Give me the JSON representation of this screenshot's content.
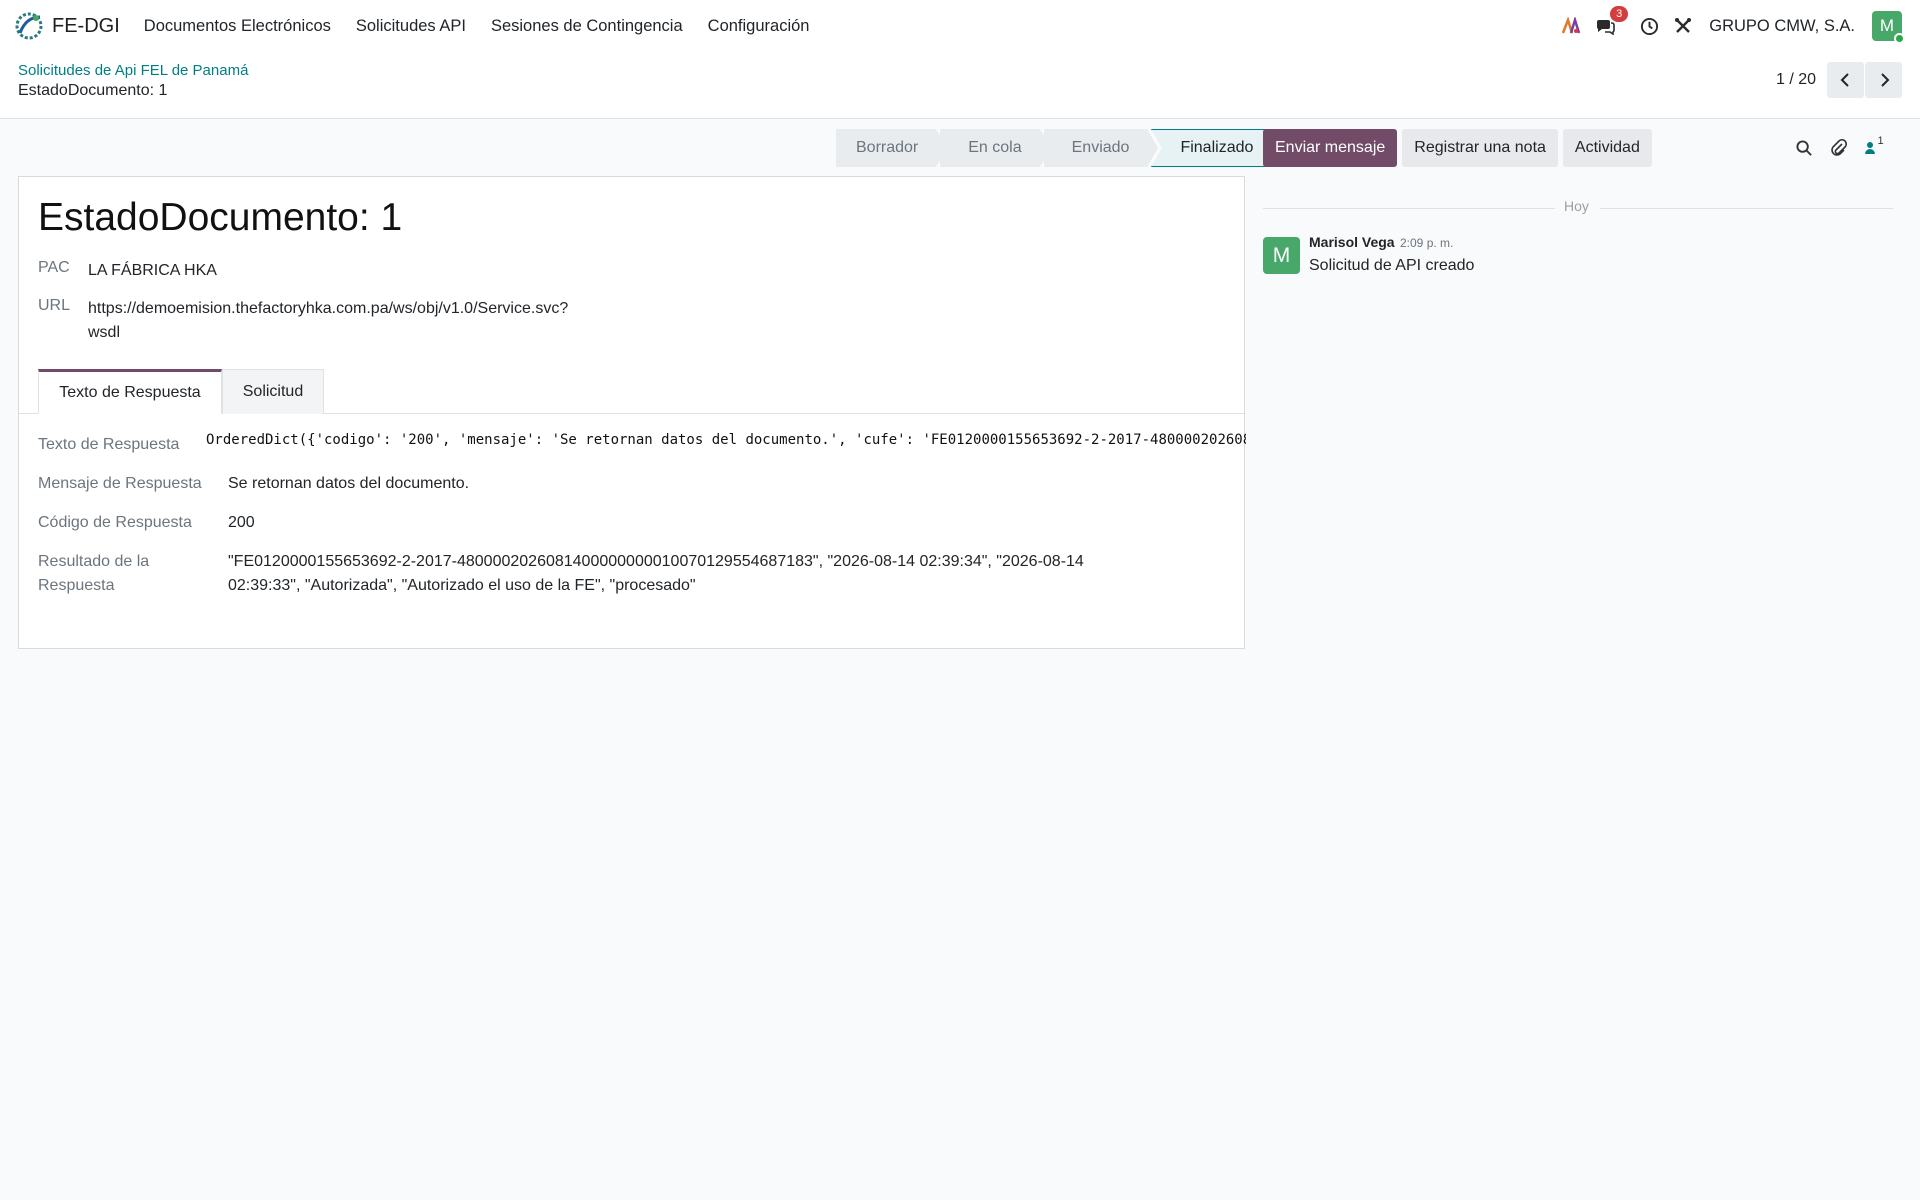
{
  "navbar": {
    "app_name": "FE-DGI",
    "menu": [
      "Documentos Electrónicos",
      "Solicitudes API",
      "Sesiones de Contingencia",
      "Configuración"
    ],
    "message_count": "3",
    "company": "GRUPO CMW, S.A.",
    "avatar_letter": "M",
    "icons": [
      "ai-icon",
      "chat-icon",
      "clock-icon",
      "tools-icon"
    ]
  },
  "control_panel": {
    "breadcrumb": "Solicitudes de Api FEL de Panamá",
    "record_name": "EstadoDocumento: 1",
    "pager": "1 / 20"
  },
  "statusbar": {
    "stages": [
      "Borrador",
      "En cola",
      "Enviado",
      "Finalizado"
    ],
    "current": "Finalizado"
  },
  "form": {
    "title": "EstadoDocumento: 1",
    "pac_label": "PAC",
    "pac_value": "LA FÁBRICA HKA",
    "url_label": "URL",
    "url_line1": "https://demoemision.thefactoryhka.com.pa/ws/obj/v1.0/Service.svc?",
    "url_line2": "wsdl",
    "tabs": [
      "Texto de Respuesta",
      "Solicitud"
    ],
    "fields": {
      "texto_label": "Texto de Respuesta",
      "texto_value": "OrderedDict({'codigo': '200', 'mensaje': 'Se retornan datos del documento.', 'cufe': 'FE0120000155653692-2-2017-480000202608",
      "mensaje_label": "Mensaje de Respuesta",
      "mensaje_value": "Se retornan datos del documento.",
      "codigo_label": "Código de Respuesta",
      "codigo_value": "200",
      "resultado_label_1": "Resultado de la",
      "resultado_label_2": "Respuesta",
      "resultado_line1": "\"FE0120000155653692-2-2017-48000020260814000000000100701295546871​83\", \"2026-08-14 02:39:34\", \"2026-08-14",
      "resultado_line2": "02:39:33\", \"Autorizada\", \"Autorizado el uso de la FE\", \"procesado\""
    }
  },
  "chatter": {
    "buttons": [
      "Enviar mensaje",
      "Registrar una nota",
      "Actividad"
    ],
    "follower_count": "1",
    "separator": "Hoy",
    "message": {
      "avatar_letter": "M",
      "author": "Marisol Vega",
      "time": "2:09 p. m.",
      "body": "Solicitud de API creado"
    }
  },
  "colors": {
    "primary": "#714b67",
    "link": "#017e84",
    "avatar": "#48a86a",
    "badge": "#d23d3d"
  }
}
